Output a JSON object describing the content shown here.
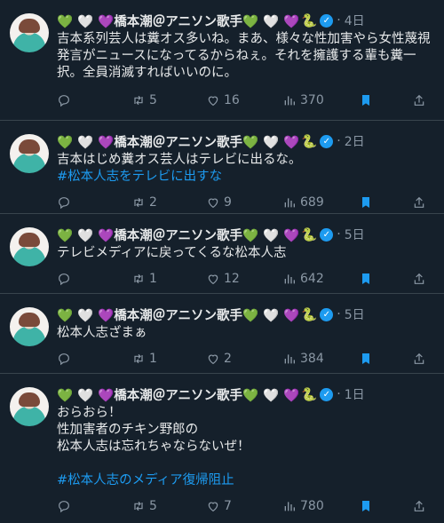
{
  "user": {
    "display_name": "💚 🤍 💜橋本潮＠アニソン歌手💚 🤍 💜",
    "snake": "🐍"
  },
  "colors": {
    "background": "#15202b",
    "accent": "#1d9bf0",
    "muted": "#8b98a5",
    "text": "#e7e9ea",
    "divider": "#38444d"
  },
  "tweets": [
    {
      "time": "4日",
      "text": "吉本系列芸人は糞オス多いね。まあ、様々な性加害やら女性蔑視発言がニュースになってるからねぇ。それを擁護する輩も糞一択。全員消滅すればいいのに。",
      "hashtag": "",
      "retweets": "5",
      "likes": "16",
      "views": "370"
    },
    {
      "time": "2日",
      "text": "吉本はじめ糞オス芸人はテレビに出るな。",
      "hashtag": "#松本人志をテレビに出すな",
      "retweets": "2",
      "likes": "9",
      "views": "689"
    },
    {
      "time": "5日",
      "text": "テレビメディアに戻ってくるな松本人志",
      "hashtag": "",
      "retweets": "1",
      "likes": "12",
      "views": "642"
    },
    {
      "time": "5日",
      "text": "松本人志ざまぁ",
      "hashtag": "",
      "retweets": "1",
      "likes": "2",
      "views": "384"
    },
    {
      "time": "1日",
      "text": "おらおら！\n性加害者のチキン野郎の\n松本人志は忘れちゃならないぜ！",
      "hashtag": "#松本人志のメディア復帰阻止",
      "retweets": "5",
      "likes": "7",
      "views": "780"
    }
  ]
}
